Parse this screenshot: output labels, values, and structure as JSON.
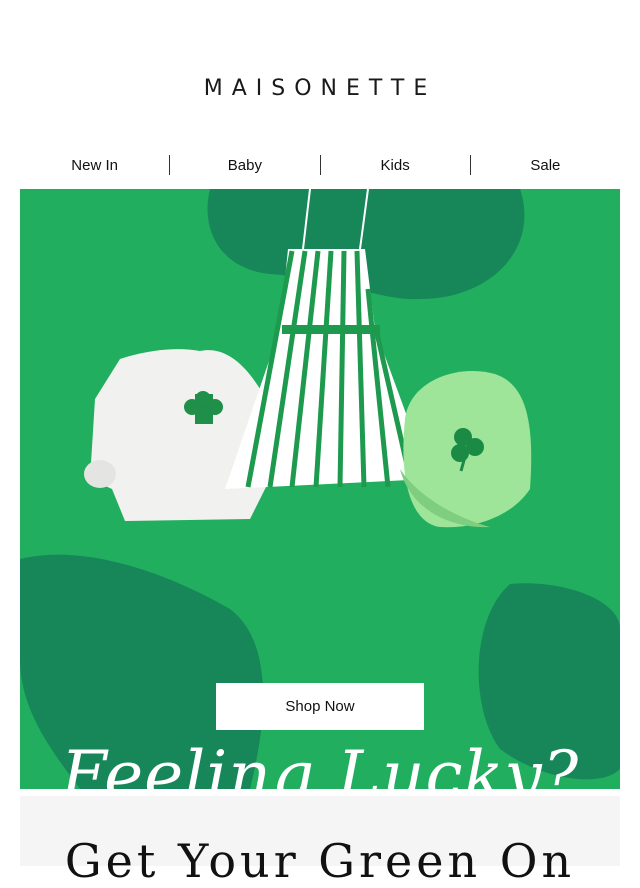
{
  "brand": {
    "logo_text": "MAISONETTE"
  },
  "nav": {
    "items": [
      {
        "label": "New In"
      },
      {
        "label": "Baby"
      },
      {
        "label": "Kids"
      },
      {
        "label": "Sale"
      }
    ]
  },
  "hero": {
    "headline": "Feeling Lucky?",
    "cta_label": "Shop Now",
    "colors": {
      "background": "#22ae5f",
      "blob": "#17875a",
      "cap": "#9ee59a"
    }
  },
  "next_section": {
    "title": "Get Your Green On"
  }
}
